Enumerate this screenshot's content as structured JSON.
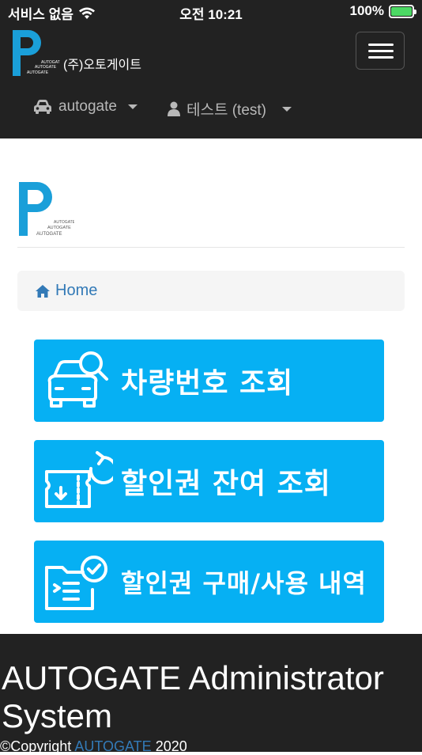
{
  "statusbar": {
    "carrier": "서비스 없음",
    "time": "오전 10:21",
    "battery": "100%"
  },
  "header": {
    "brand_name": "(주)오토게이트",
    "logo_letter": "P",
    "logo_sub": "AUTOGATE",
    "nav": [
      {
        "label": "autogate",
        "icon": "car-icon"
      },
      {
        "label": "테스트 (test)",
        "icon": "user-icon"
      }
    ]
  },
  "breadcrumb": {
    "home_label": "Home"
  },
  "menu": [
    {
      "label": "차량번호 조회",
      "icon": "car-search-icon"
    },
    {
      "label": "할인권 잔여 조회",
      "icon": "ticket-refresh-icon"
    },
    {
      "label": "할인권 구매/사용 내역",
      "icon": "folder-check-icon"
    }
  ],
  "footer": {
    "title": "AUTOGATE Administrator System",
    "copyright_prefix": "©Copyright",
    "copyright_link": "AUTOGATE",
    "copyright_year": "2020"
  },
  "colors": {
    "brand_blue": "#1a9fd9",
    "button_blue": "#06b0f3",
    "dark": "#222222",
    "link": "#337ab7"
  }
}
